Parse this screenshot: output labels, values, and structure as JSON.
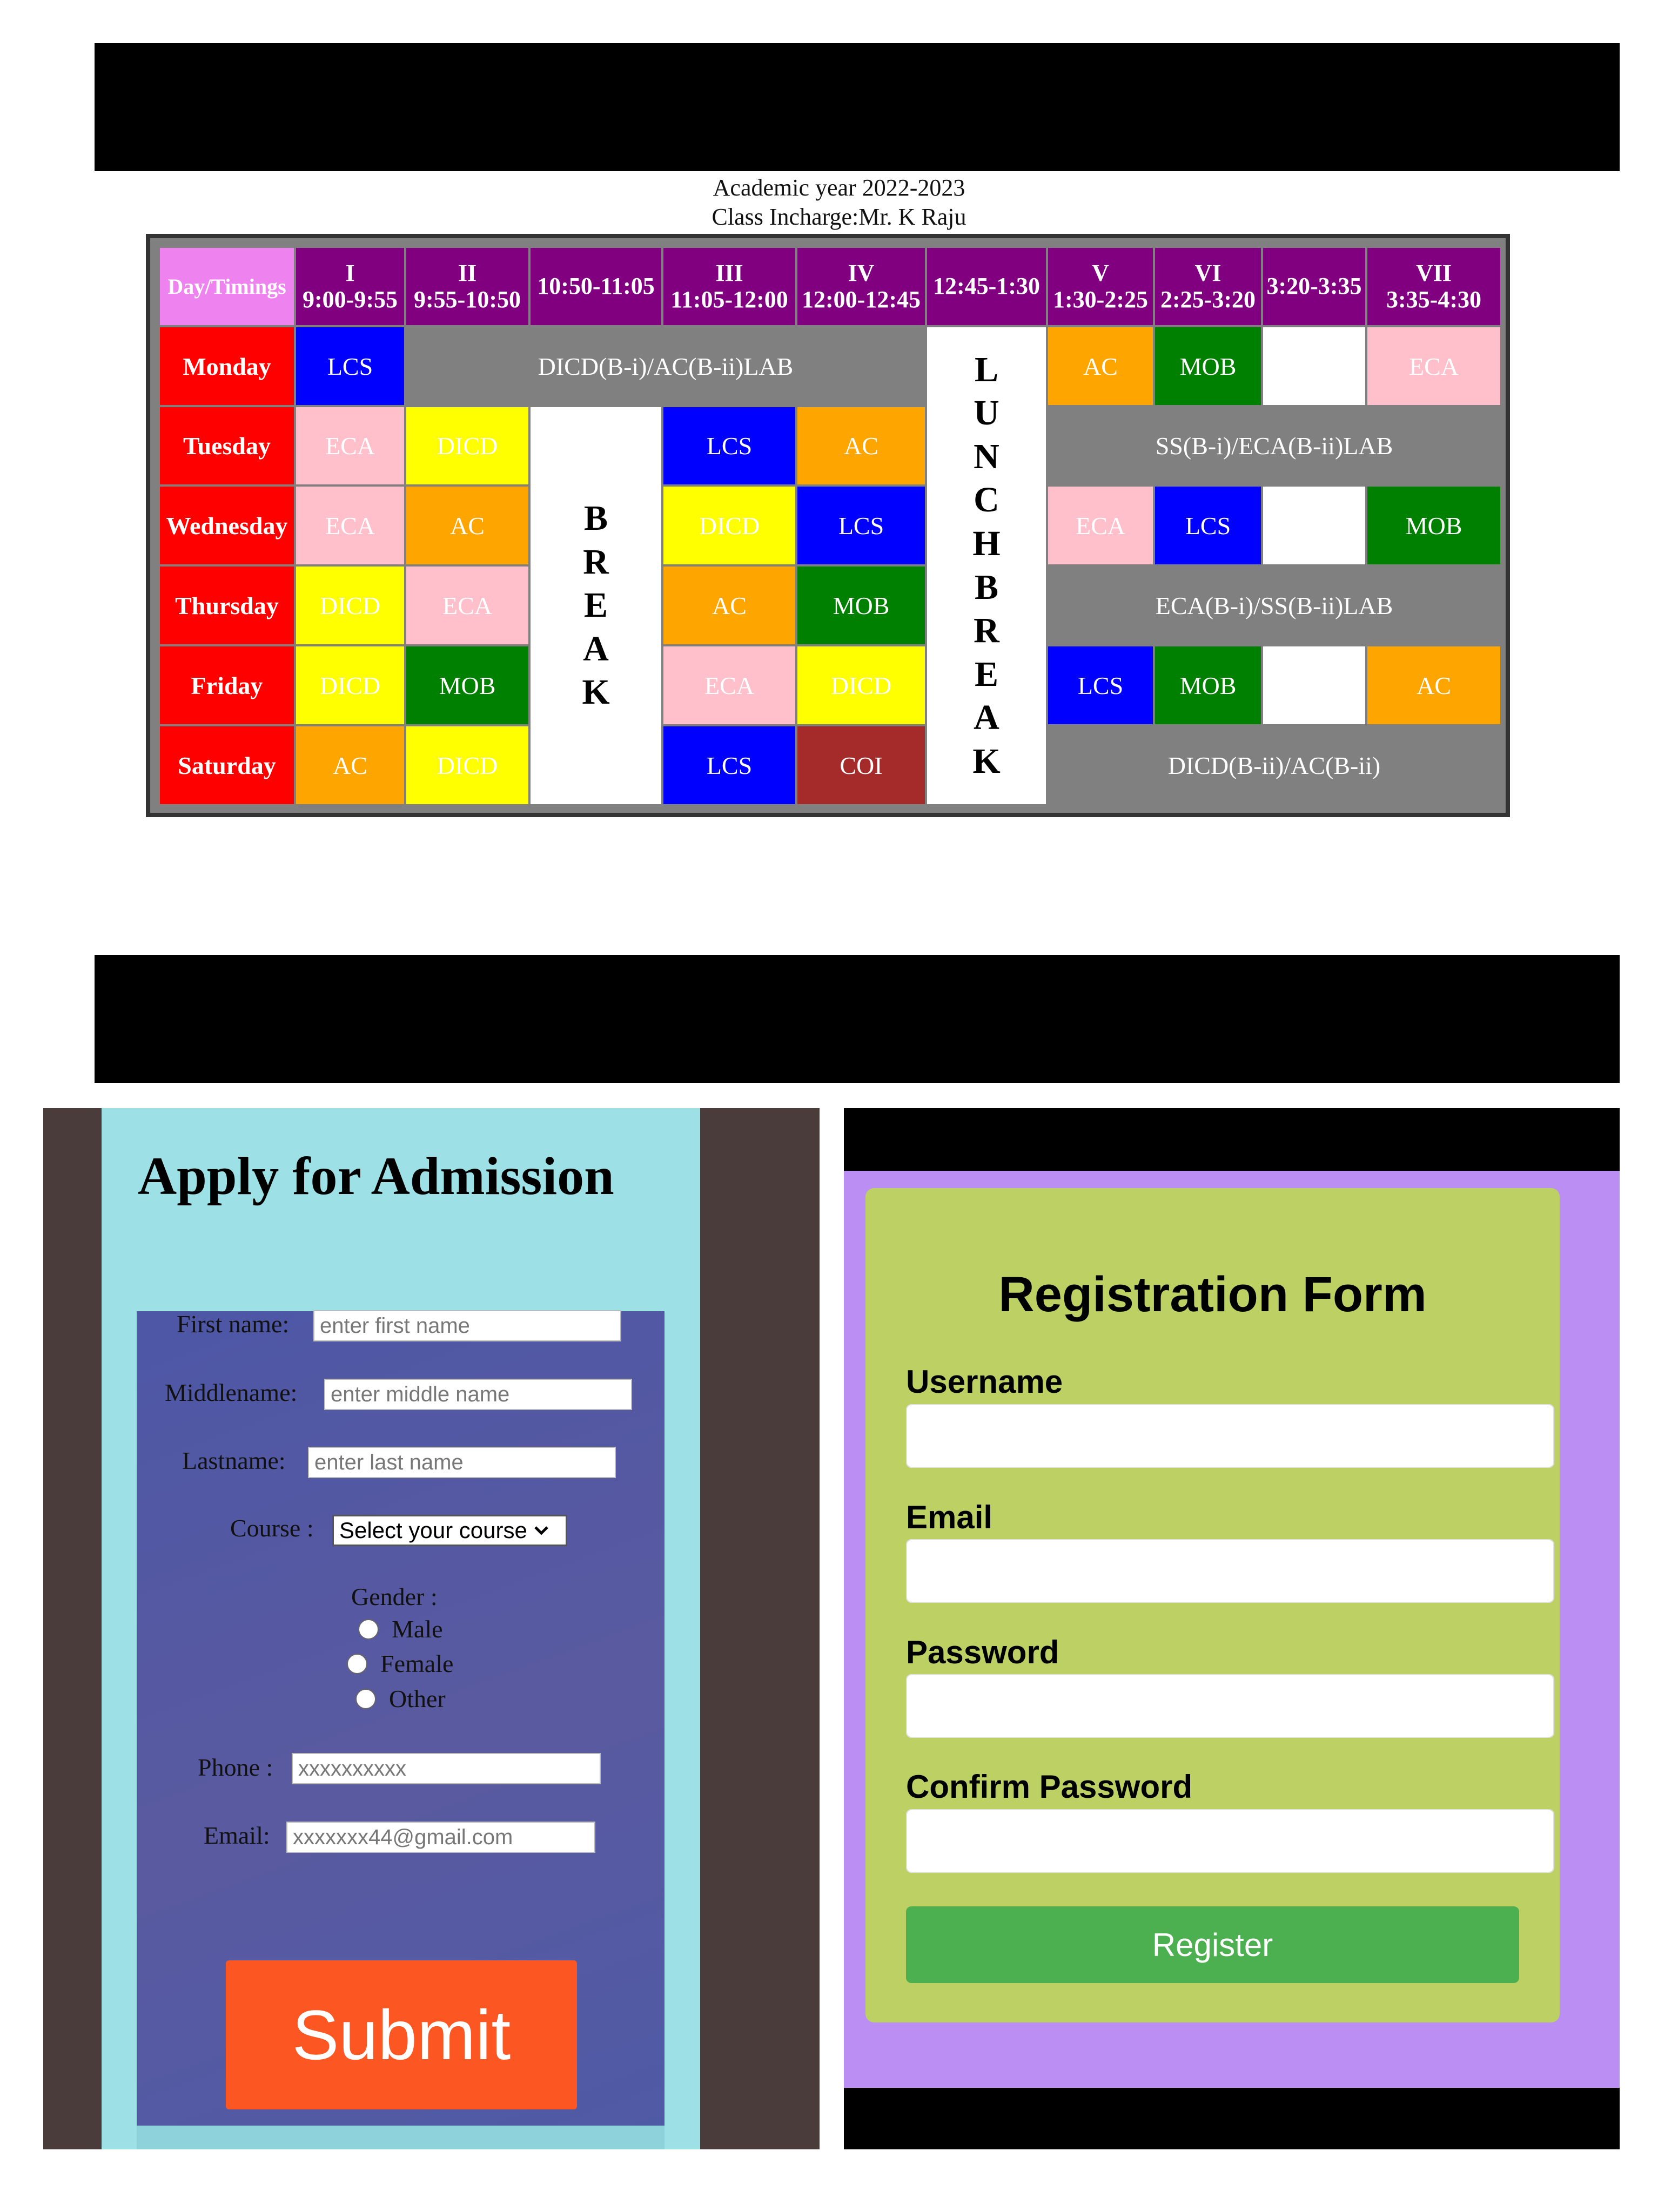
{
  "timetable": {
    "academic_year": "Academic year 2022-2023",
    "class_incharge": "Class Incharge:Mr. K Raju",
    "corner_header": "Day/Timings",
    "periods": [
      {
        "num": "I",
        "time": "9:00-9:55"
      },
      {
        "num": "II",
        "time": "9:55-10:50"
      },
      {
        "num": "",
        "time": "10:50-11:05"
      },
      {
        "num": "III",
        "time": "11:05-12:00"
      },
      {
        "num": "IV",
        "time": "12:00-12:45"
      },
      {
        "num": "",
        "time": "12:45-1:30"
      },
      {
        "num": "V",
        "time": "1:30-2:25"
      },
      {
        "num": "VI",
        "time": "2:25-3:20"
      },
      {
        "num": "",
        "time": "3:20-3:35"
      },
      {
        "num": "VII",
        "time": "3:35-4:30"
      }
    ],
    "days": [
      "Monday",
      "Tuesday",
      "Wednesday",
      "Thursday",
      "Friday",
      "Saturday"
    ],
    "break_letters": [
      "B",
      "R",
      "E",
      "A",
      "K"
    ],
    "lunch_letters": [
      "L",
      "U",
      "N",
      "C",
      "H",
      "B",
      "R",
      "E",
      "A",
      "K"
    ],
    "cells": {
      "mon_1": "LCS",
      "mon_lab": "DICD(B-i)/AC(B-ii)LAB",
      "mon_5": "AC",
      "mon_6": "MOB",
      "mon_7": "ECA",
      "tue_1": "ECA",
      "tue_2": "DICD",
      "tue_3": "LCS",
      "tue_4": "AC",
      "tue_lab": "SS(B-i)/ECA(B-ii)LAB",
      "wed_1": "ECA",
      "wed_2": "AC",
      "wed_3": "DICD",
      "wed_4": "LCS",
      "wed_5": "ECA",
      "wed_6": "LCS",
      "wed_7": "MOB",
      "thu_1": "DICD",
      "thu_2": "ECA",
      "thu_3": "AC",
      "thu_4": "MOB",
      "thu_lab": "ECA(B-i)/SS(B-ii)LAB",
      "fri_1": "DICD",
      "fri_2": "MOB",
      "fri_3": "ECA",
      "fri_4": "DICD",
      "fri_5": "LCS",
      "fri_6": "MOB",
      "fri_7": "AC",
      "sat_1": "AC",
      "sat_2": "DICD",
      "sat_3": "LCS",
      "sat_4": "COI",
      "sat_lab": "DICD(B-ii)/AC(B-ii)"
    }
  },
  "admission": {
    "title": "Apply for Admission",
    "first_name_label": "First name:",
    "first_name_placeholder": "enter first name",
    "middle_name_label": "Middlename:",
    "middle_name_placeholder": "enter middle name",
    "last_name_label": "Lastname:",
    "last_name_placeholder": "enter last name",
    "course_label": "Course :",
    "course_selected": "Select your course",
    "gender_label": "Gender :",
    "gender_options": [
      "Male",
      "Female",
      "Other"
    ],
    "phone_label": "Phone :",
    "phone_placeholder": "xxxxxxxxxx",
    "email_label": "Email:",
    "email_placeholder": "xxxxxxx44@gmail.com",
    "submit_label": "Submit"
  },
  "registration": {
    "title": "Registration Form",
    "username_label": "Username",
    "email_label": "Email",
    "password_label": "Password",
    "confirm_password_label": "Confirm Password",
    "register_label": "Register"
  },
  "colors": {
    "header_purple": "#800080",
    "day_red": "#ff0000",
    "submit_orange": "#fc5722",
    "register_green": "#4caf50",
    "registration_bg": "#bb8ef3",
    "registration_card": "#bdd064"
  }
}
